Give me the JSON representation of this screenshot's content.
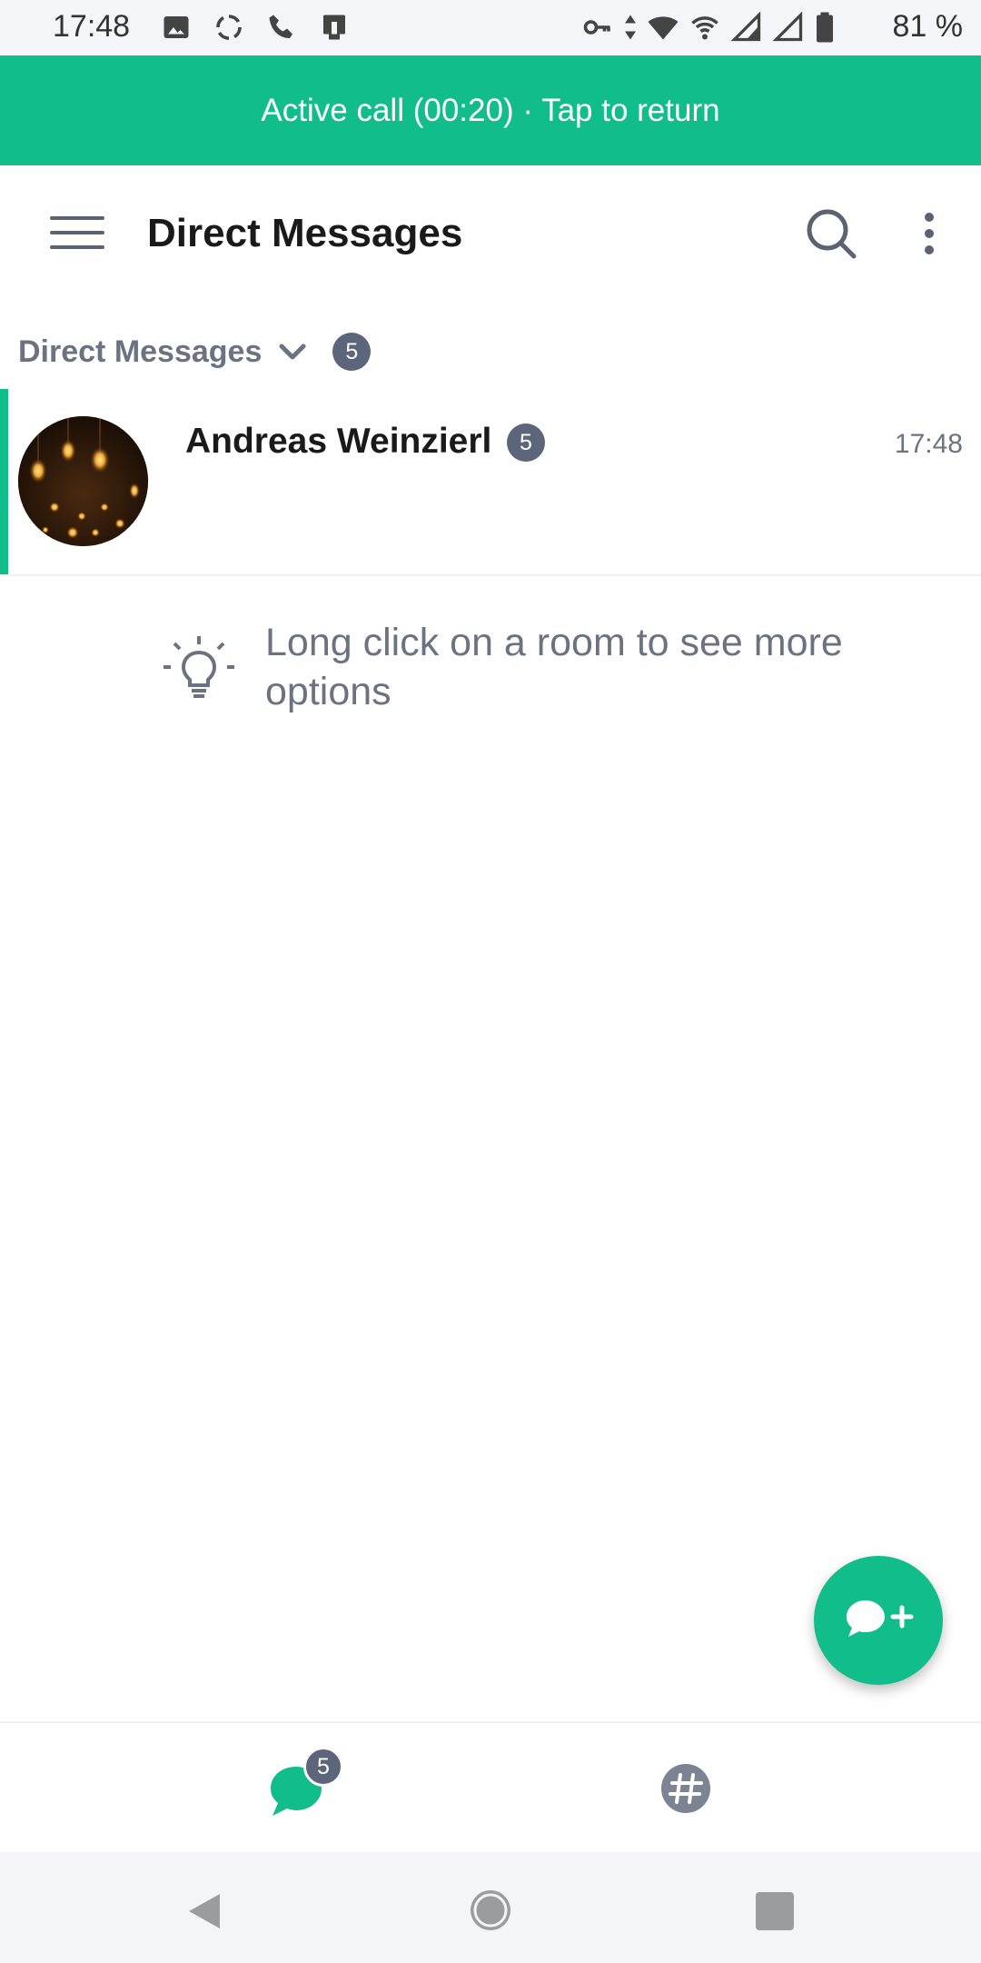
{
  "status_bar": {
    "time": "17:48",
    "battery": "81 %",
    "left_icons": [
      "image-icon",
      "sync-icon",
      "phone-icon",
      "cast-icon"
    ],
    "right_icons": [
      "vpn-key-icon",
      "data-arrows-icon",
      "wifi-icon",
      "hotspot-icon",
      "signal-icon",
      "signal-icon",
      "battery-icon"
    ]
  },
  "call_banner": {
    "text": "Active call (00:20) · Tap to return"
  },
  "app_bar": {
    "title": "Direct Messages",
    "icons": [
      "menu-icon",
      "search-icon",
      "more-vert-icon"
    ]
  },
  "section": {
    "title": "Direct Messages",
    "badge": "5"
  },
  "rooms": [
    {
      "name": "Andreas Weinzierl",
      "badge": "5",
      "time": "17:48"
    }
  ],
  "hint": {
    "text": "Long click on a room to see more options"
  },
  "bottom_nav": {
    "dm_badge": "5",
    "icons": [
      "chat-bubble-icon",
      "hashtag-icon"
    ]
  },
  "colors": {
    "accent": "#12bd8c",
    "badge": "#5c6579",
    "muted_text": "#6b7280",
    "status_bar_bg": "#f4f5f8"
  }
}
